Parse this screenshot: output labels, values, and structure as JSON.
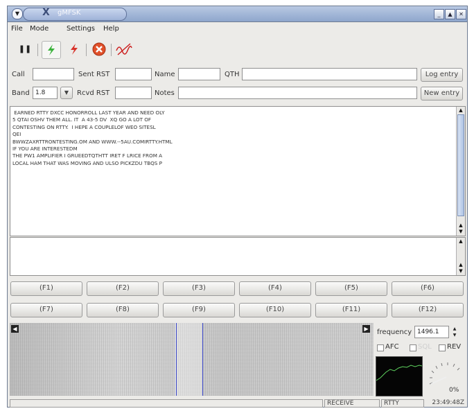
{
  "window": {
    "app_letter": "X",
    "title": "gMFSK"
  },
  "menu": {
    "file": "File",
    "mode": "Mode",
    "settings": "Settings",
    "help": "Help"
  },
  "toolbar": {
    "pause_glyph": "❚❚"
  },
  "qso": {
    "call_label": "Call",
    "call_value": "",
    "sent_rst_label": "Sent RST",
    "sent_rst_value": "",
    "name_label": "Name",
    "name_value": "",
    "qth_label": "QTH",
    "qth_value": "",
    "band_label": "Band",
    "band_value": "1.8",
    "rcvd_rst_label": "Rcvd RST",
    "rcvd_rst_value": "",
    "notes_label": "Notes",
    "notes_value": "",
    "log_entry_button": "Log entry",
    "new_entry_button": "New entry"
  },
  "rx_text": [
    " EARNED RTTY DXCC HONORROLL LAST YEAR AND NEED OLY",
    "5 QTAI OSHV THEM ALL. IT  A 43-5 DV  XQ GO A LOT OF",
    "CONTESTING ON RTTY.  I HEPE A COUPLELOF WEO SITESL",
    "QEI",
    "BWWZAXRTTRONTESTING.OM AND WWW.--5AU.COMIRTTY.HTML",
    "IF YOU ARE INTERESTEDM",
    "THE PW1 AMPLIFIER I GRUEEDTQTHTT IRET F LRICE FROM A",
    "LOCAL HAM THAT WAS MOVING AND ULSO PICKZDU TBQS P"
  ],
  "macros_row1": [
    "(F1)",
    "(F2)",
    "(F3)",
    "(F4)",
    "(F5)",
    "(F6)"
  ],
  "macros_row2": [
    "(F7)",
    "(F8)",
    "(F9)",
    "(F10)",
    "(F11)",
    "(F12)"
  ],
  "waterfall": {
    "left_arrow": "◀",
    "right_arrow": "▶"
  },
  "controls": {
    "frequency_label": "frequency",
    "frequency_value": "1496.1",
    "afc_label": "AFC",
    "sql_label": "SQL",
    "rev_label": "REV",
    "squelch_percent": "0%"
  },
  "status": {
    "message": "",
    "state": "RECEIVE",
    "mode": "RTTY",
    "time": "23:49:48Z"
  },
  "colors": {
    "titlebar": "#9fb3d8",
    "waterfall_marker": "#3a46c8",
    "spectrum_trace": "#5fd35f",
    "stop_button": "#e0502a"
  }
}
